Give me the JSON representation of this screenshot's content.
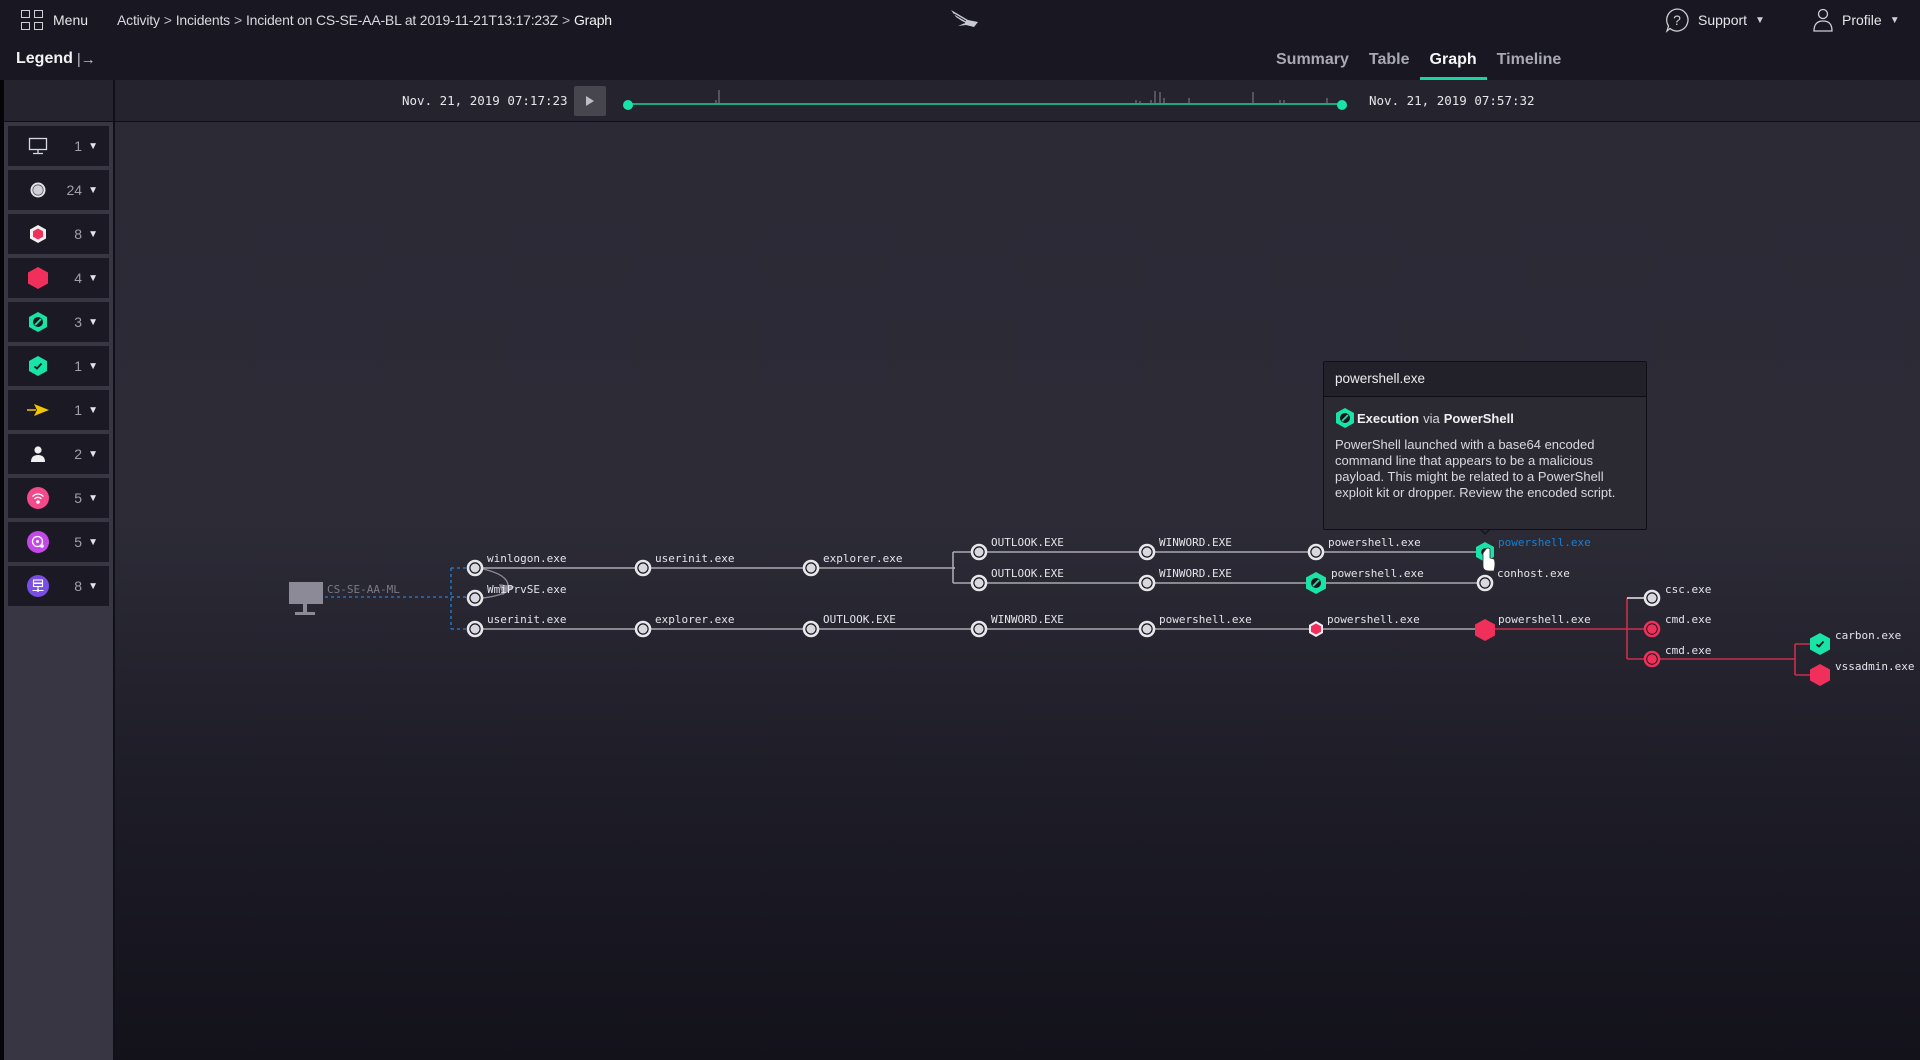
{
  "header": {
    "menu_label": "Menu",
    "breadcrumb": [
      "Activity",
      "Incidents",
      "Incident on CS-SE-AA-BL at 2019-11-21T13:17:23Z",
      "Graph"
    ],
    "breadcrumb_separator": ">",
    "logo_icon": "falcon-logo-icon",
    "support_label": "Support",
    "profile_label": "Profile"
  },
  "legend": {
    "title": "Legend",
    "toggle_glyph": "|→",
    "items": [
      {
        "icon": "host-monitor-icon",
        "count": "1"
      },
      {
        "icon": "process-circle-icon",
        "count": "24"
      },
      {
        "icon": "detection-hexagon-outline-icon",
        "count": "8"
      },
      {
        "icon": "detection-hexagon-solid-icon",
        "count": "4"
      },
      {
        "icon": "prevented-hexagon-icon",
        "count": "3"
      },
      {
        "icon": "verified-hexagon-icon",
        "count": "1"
      },
      {
        "icon": "arrow-indicator-icon",
        "count": "1"
      },
      {
        "icon": "user-icon",
        "count": "2"
      },
      {
        "icon": "network-wifi-icon",
        "count": "5"
      },
      {
        "icon": "disk-icon",
        "count": "5"
      },
      {
        "icon": "network-share-icon",
        "count": "8"
      }
    ]
  },
  "tabs": [
    {
      "label": "Summary",
      "active": false
    },
    {
      "label": "Table",
      "active": false
    },
    {
      "label": "Graph",
      "active": true
    },
    {
      "label": "Timeline",
      "active": false
    }
  ],
  "timeline": {
    "start": "Nov. 21, 2019 07:17:23",
    "end": "Nov. 21, 2019 07:57:32",
    "accent_color": "#19d3a0"
  },
  "graph": {
    "host": {
      "label": "CS-SE-AA-ML"
    },
    "rows": [
      {
        "nodes": [
          "winlogon.exe",
          "userinit.exe",
          "explorer.exe"
        ]
      },
      {
        "nodes": [
          "WmiPrvSE.exe"
        ]
      },
      {
        "nodes": [
          "userinit.exe",
          "explorer.exe",
          "OUTLOOK.EXE",
          "WINWORD.EXE",
          "powershell.exe",
          "powershell.exe",
          "powershell.exe"
        ]
      }
    ],
    "branch_a": [
      "OUTLOOK.EXE",
      "WINWORD.EXE",
      "powershell.exe",
      "powershell.exe"
    ],
    "branch_b": [
      "OUTLOOK.EXE",
      "WINWORD.EXE",
      "powershell.exe",
      "conhost.exe"
    ],
    "children_of_powershell": [
      "csc.exe",
      "cmd.exe",
      "cmd.exe"
    ],
    "children_of_cmd": [
      "carbon.exe",
      "vssadmin.exe"
    ],
    "colors": {
      "clean": "#e8e8ec",
      "prevented": "#19e3a6",
      "critical": "#f0305a",
      "link": "#a9a9b0",
      "critical_link": "#c8304d",
      "hover_label": "#1a7fd0"
    }
  },
  "tooltip": {
    "title": "powershell.exe",
    "tactic": "Execution",
    "via": "via",
    "technique": "PowerShell",
    "description": "PowerShell launched with a base64 encoded command line that appears to be a malicious payload. This might be related to a PowerShell exploit kit or dropper. Review the encoded script."
  }
}
